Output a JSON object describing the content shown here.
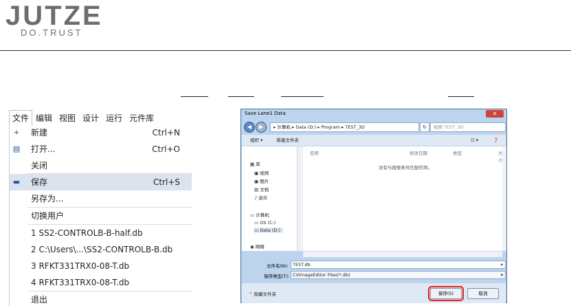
{
  "logo": {
    "brand": "JUTZE",
    "tagline": "DO.TRUST"
  },
  "menubar": [
    "文件",
    "编辑",
    "视图",
    "设计",
    "运行",
    "元件库"
  ],
  "file_menu": [
    {
      "icon": "new-file-icon",
      "label": "新建",
      "shortcut": "Ctrl+N"
    },
    {
      "icon": "open-folder-icon",
      "label": "打开...",
      "shortcut": "Ctrl+O"
    },
    {
      "icon": "",
      "label": "关闭",
      "shortcut": ""
    },
    {
      "icon": "save-icon",
      "label": "保存",
      "shortcut": "Ctrl+S"
    },
    {
      "icon": "",
      "label": "另存为...",
      "shortcut": ""
    },
    {
      "icon": "",
      "label": "切换用户",
      "shortcut": ""
    },
    {
      "icon": "",
      "label": "1 SS2-CONTROLB-B-half.db",
      "shortcut": ""
    },
    {
      "icon": "",
      "label": "2 C:\\Users\\...\\SS2-CONTROLB-B.db",
      "shortcut": ""
    },
    {
      "icon": "",
      "label": "3 RFKT331TRX0-08-T.db",
      "shortcut": ""
    },
    {
      "icon": "",
      "label": "4 RFKT331TRX0-08-T.db",
      "shortcut": ""
    },
    {
      "icon": "",
      "label": "退出",
      "shortcut": ""
    }
  ],
  "dialog": {
    "title": "Save Lane1 Data",
    "close": "✕",
    "breadcrumb": "▸ 计算机 ▸ Data (D:) ▸ Program ▸ TEST_3D",
    "search_placeholder": "搜索 TEST_3D",
    "organize": "组织 ▾",
    "new_folder": "新建文件夹",
    "sidebar": [
      {
        "icon": "library-icon",
        "label": "库"
      },
      {
        "icon": "video-icon",
        "label": "视频"
      },
      {
        "icon": "picture-icon",
        "label": "图片"
      },
      {
        "icon": "document-icon",
        "label": "文档"
      },
      {
        "icon": "music-icon",
        "label": "音乐"
      },
      {
        "icon": "computer-icon",
        "label": "计算机"
      },
      {
        "icon": "drive-icon",
        "label": "OS (C:)"
      },
      {
        "icon": "drive-icon",
        "label": "Data (D:)"
      },
      {
        "icon": "network-icon",
        "label": "网络"
      }
    ],
    "columns": [
      "名称",
      "修改日期",
      "类型",
      "大小"
    ],
    "empty_text": "没有与搜索条件匹配的项。",
    "filename_label": "文件名(N):",
    "filename_value": "TEST.db",
    "filetype_label": "保存类型(T):",
    "filetype_value": "CVImageEditor Files(*.db)",
    "hide_folders": "隐藏文件夹",
    "save_button": "保存(S)",
    "cancel_button": "取消"
  }
}
